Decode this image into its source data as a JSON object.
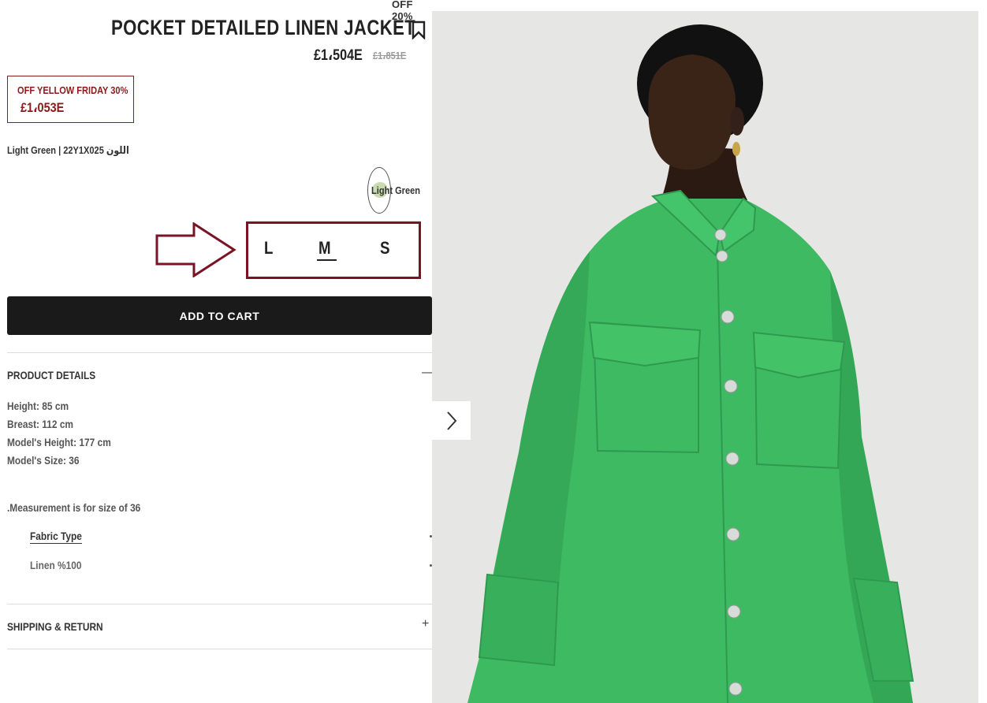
{
  "product": {
    "discount_tag": "OFF 20%",
    "title": "POCKET DETAILED LINEN JACKET",
    "price_now": "£1،504E",
    "price_old": "£1،851E",
    "promo": {
      "label": "OFF YELLOW FRIDAY 30%",
      "price": "£1،053E"
    },
    "color_line": "Light Green | 22Y1X025 اللون",
    "color_swatch": {
      "label": "Light Green",
      "color": "#c9dcb0"
    },
    "sizes": [
      "L",
      "M",
      "S"
    ],
    "selected_size": "M",
    "add_to_cart": "ADD TO CART"
  },
  "details": {
    "title": "PRODUCT DETAILS",
    "toggle": "—",
    "lines": [
      "Height: 85 cm",
      "Breast: 112 cm",
      "Model's Height: 177 cm",
      "Model's Size: 36"
    ],
    "note": ".Measurement is for size of 36",
    "fabric_type_label": "Fabric Type",
    "fabric_value": "Linen %100"
  },
  "shipping": {
    "title": "SHIPPING & RETURN",
    "toggle": "+"
  },
  "colors": {
    "accent": "#7a1424",
    "promo": "#8b1a1a",
    "button_bg": "#1a1a1a",
    "jacket": "#3dba62"
  },
  "icons": {
    "bookmark": "bookmark-icon",
    "arrow": "arrow-right-outline-icon",
    "next": "chevron-right-icon"
  }
}
